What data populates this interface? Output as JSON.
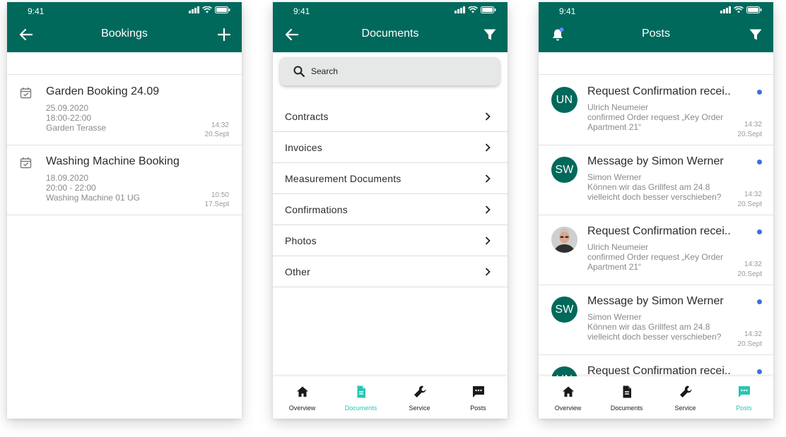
{
  "status": {
    "time": "9:41"
  },
  "bookings": {
    "title": "Bookings",
    "items": [
      {
        "title": "Garden Booking 24.09",
        "date": "25.09.2020",
        "time_range": "18:00-22:00",
        "location": "Garden Terasse",
        "time": "14:32",
        "day": "20.Sept"
      },
      {
        "title": "Washing Machine Booking",
        "date": "18.09.2020",
        "time_range": "20:00 - 22:00",
        "location": "Washing Machine 01 UG",
        "time": "10:50",
        "day": "17.Sept"
      }
    ]
  },
  "documents": {
    "title": "Documents",
    "search_placeholder": "Search",
    "items": [
      {
        "label": "Contracts"
      },
      {
        "label": "Invoices"
      },
      {
        "label": "Measurement Documents"
      },
      {
        "label": "Confirmations"
      },
      {
        "label": "Photos"
      },
      {
        "label": "Other"
      }
    ]
  },
  "posts": {
    "title": "Posts",
    "items": [
      {
        "initials": "UN",
        "title": "Request Confirmation recei..",
        "line1": "Ulrich Neumeier",
        "line2": "confirmed Order request „Key Order",
        "line3": "Apartment 21“",
        "time": "14:32",
        "day": "20.Sept"
      },
      {
        "initials": "SW",
        "title": "Message by Simon Werner",
        "line1": "Simon Werner",
        "line2": "Können wir das Grillfest am 24.8",
        "line3": "vielleicht doch besser verschieben?",
        "time": "14:32",
        "day": "20.Sept"
      },
      {
        "initials": "",
        "title": "Request Confirmation recei..",
        "line1": "Ulrich Neumeier",
        "line2": "confirmed Order request „Key Order",
        "line3": "Apartment 21“",
        "time": "14:32",
        "day": "20.Sept"
      },
      {
        "initials": "SW",
        "title": "Message by Simon Werner",
        "line1": "Simon Werner",
        "line2": "Können wir das Grillfest am 24.8",
        "line3": "vielleicht doch besser verschieben?",
        "time": "14:32",
        "day": "20.Sept"
      },
      {
        "initials": "UN",
        "title": "Request Confirmation recei.."
      }
    ]
  },
  "nav": {
    "overview": "Overview",
    "documents": "Documents",
    "service": "Service",
    "posts": "Posts"
  },
  "colors": {
    "header": "#00695c",
    "active_nav": "#26c6b5",
    "unread_dot": "#3b6fe0"
  },
  "icons": {
    "back": "arrow-left-icon",
    "add": "plus-icon",
    "filter": "filter-icon",
    "notification": "bell-icon",
    "search": "search-icon",
    "chevron": "chevron-right-icon",
    "calendar": "calendar-check-icon"
  }
}
